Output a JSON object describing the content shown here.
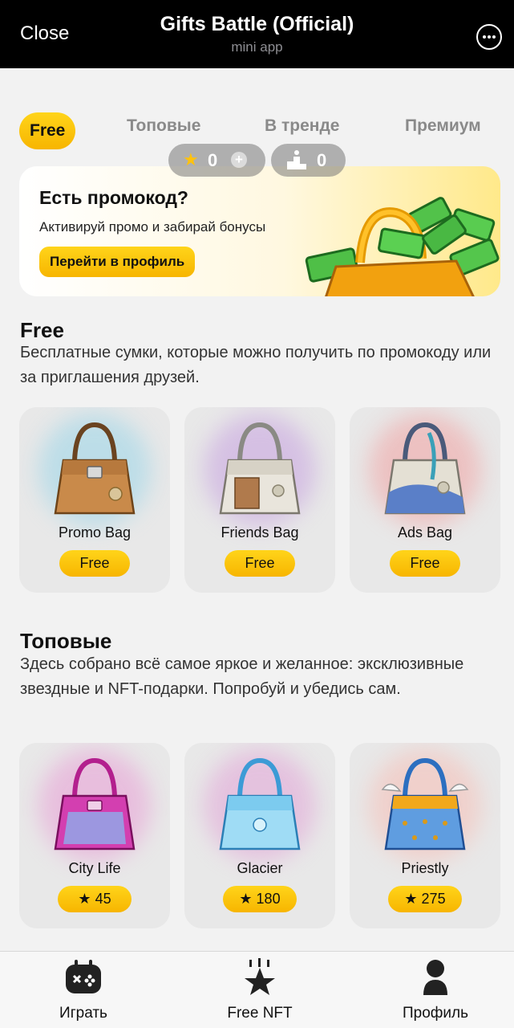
{
  "topbar": {
    "close_label": "Close",
    "title": "Gifts Battle (Official)",
    "subtitle": "mini app"
  },
  "tabs": [
    {
      "label": "Free",
      "active": true
    },
    {
      "label": "Топовые",
      "active": false
    },
    {
      "label": "В тренде",
      "active": false
    },
    {
      "label": "Премиум",
      "active": false
    }
  ],
  "balance": {
    "stars": "0",
    "rank": "0"
  },
  "promo": {
    "title": "Есть промокод?",
    "text": "Активируй промо и забирай бонусы",
    "button_label": "Перейти в профиль"
  },
  "sections": [
    {
      "title": "Free",
      "description": "Бесплатные сумки, которые можно получить по промокоду или за приглашения друзей.",
      "items": [
        {
          "name": "Promo Bag",
          "price": "Free"
        },
        {
          "name": "Friends Bag",
          "price": "Free"
        },
        {
          "name": "Ads Bag",
          "price": "Free"
        }
      ]
    },
    {
      "title": "Топовые",
      "description": "Здесь собрано всё самое яркое и желанное: эксклюзивные звездные и NFT-подарки. Попробуй и убедись сам.",
      "items": [
        {
          "name": "City Life",
          "price": "45"
        },
        {
          "name": "Glacier",
          "price": "180"
        },
        {
          "name": "Priestly",
          "price": "275"
        }
      ]
    }
  ],
  "bottom_nav": [
    {
      "label": "Играть",
      "icon": "gamepad-icon"
    },
    {
      "label": "Free NFT",
      "icon": "star-icon"
    },
    {
      "label": "Профиль",
      "icon": "profile-icon"
    }
  ],
  "colors": {
    "accent": "#ffc90e",
    "topbar": "#000000",
    "background": "#f2f2f2",
    "card": "#e8e8e8"
  }
}
